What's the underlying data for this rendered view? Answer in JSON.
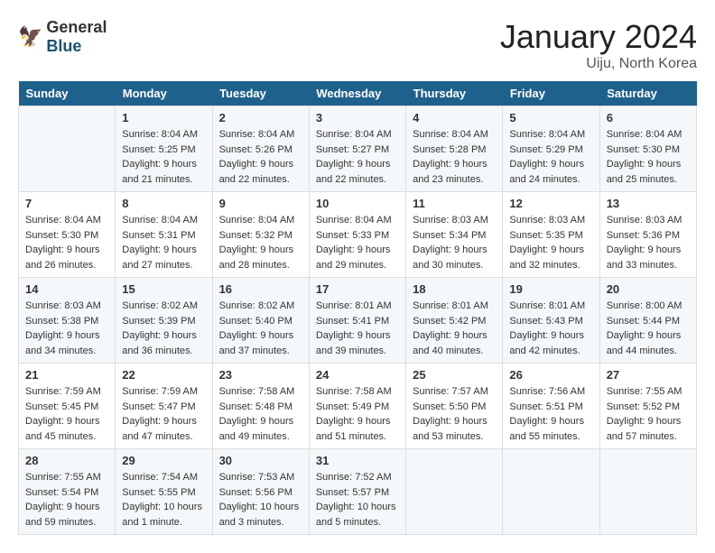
{
  "logo": {
    "general": "General",
    "blue": "Blue"
  },
  "title": {
    "month_year": "January 2024",
    "location": "Uiju, North Korea"
  },
  "headers": [
    "Sunday",
    "Monday",
    "Tuesday",
    "Wednesday",
    "Thursday",
    "Friday",
    "Saturday"
  ],
  "weeks": [
    [
      {
        "day": "",
        "content": ""
      },
      {
        "day": "1",
        "content": "Sunrise: 8:04 AM\nSunset: 5:25 PM\nDaylight: 9 hours\nand 21 minutes."
      },
      {
        "day": "2",
        "content": "Sunrise: 8:04 AM\nSunset: 5:26 PM\nDaylight: 9 hours\nand 22 minutes."
      },
      {
        "day": "3",
        "content": "Sunrise: 8:04 AM\nSunset: 5:27 PM\nDaylight: 9 hours\nand 22 minutes."
      },
      {
        "day": "4",
        "content": "Sunrise: 8:04 AM\nSunset: 5:28 PM\nDaylight: 9 hours\nand 23 minutes."
      },
      {
        "day": "5",
        "content": "Sunrise: 8:04 AM\nSunset: 5:29 PM\nDaylight: 9 hours\nand 24 minutes."
      },
      {
        "day": "6",
        "content": "Sunrise: 8:04 AM\nSunset: 5:30 PM\nDaylight: 9 hours\nand 25 minutes."
      }
    ],
    [
      {
        "day": "7",
        "content": "Sunrise: 8:04 AM\nSunset: 5:30 PM\nDaylight: 9 hours\nand 26 minutes."
      },
      {
        "day": "8",
        "content": "Sunrise: 8:04 AM\nSunset: 5:31 PM\nDaylight: 9 hours\nand 27 minutes."
      },
      {
        "day": "9",
        "content": "Sunrise: 8:04 AM\nSunset: 5:32 PM\nDaylight: 9 hours\nand 28 minutes."
      },
      {
        "day": "10",
        "content": "Sunrise: 8:04 AM\nSunset: 5:33 PM\nDaylight: 9 hours\nand 29 minutes."
      },
      {
        "day": "11",
        "content": "Sunrise: 8:03 AM\nSunset: 5:34 PM\nDaylight: 9 hours\nand 30 minutes."
      },
      {
        "day": "12",
        "content": "Sunrise: 8:03 AM\nSunset: 5:35 PM\nDaylight: 9 hours\nand 32 minutes."
      },
      {
        "day": "13",
        "content": "Sunrise: 8:03 AM\nSunset: 5:36 PM\nDaylight: 9 hours\nand 33 minutes."
      }
    ],
    [
      {
        "day": "14",
        "content": "Sunrise: 8:03 AM\nSunset: 5:38 PM\nDaylight: 9 hours\nand 34 minutes."
      },
      {
        "day": "15",
        "content": "Sunrise: 8:02 AM\nSunset: 5:39 PM\nDaylight: 9 hours\nand 36 minutes."
      },
      {
        "day": "16",
        "content": "Sunrise: 8:02 AM\nSunset: 5:40 PM\nDaylight: 9 hours\nand 37 minutes."
      },
      {
        "day": "17",
        "content": "Sunrise: 8:01 AM\nSunset: 5:41 PM\nDaylight: 9 hours\nand 39 minutes."
      },
      {
        "day": "18",
        "content": "Sunrise: 8:01 AM\nSunset: 5:42 PM\nDaylight: 9 hours\nand 40 minutes."
      },
      {
        "day": "19",
        "content": "Sunrise: 8:01 AM\nSunset: 5:43 PM\nDaylight: 9 hours\nand 42 minutes."
      },
      {
        "day": "20",
        "content": "Sunrise: 8:00 AM\nSunset: 5:44 PM\nDaylight: 9 hours\nand 44 minutes."
      }
    ],
    [
      {
        "day": "21",
        "content": "Sunrise: 7:59 AM\nSunset: 5:45 PM\nDaylight: 9 hours\nand 45 minutes."
      },
      {
        "day": "22",
        "content": "Sunrise: 7:59 AM\nSunset: 5:47 PM\nDaylight: 9 hours\nand 47 minutes."
      },
      {
        "day": "23",
        "content": "Sunrise: 7:58 AM\nSunset: 5:48 PM\nDaylight: 9 hours\nand 49 minutes."
      },
      {
        "day": "24",
        "content": "Sunrise: 7:58 AM\nSunset: 5:49 PM\nDaylight: 9 hours\nand 51 minutes."
      },
      {
        "day": "25",
        "content": "Sunrise: 7:57 AM\nSunset: 5:50 PM\nDaylight: 9 hours\nand 53 minutes."
      },
      {
        "day": "26",
        "content": "Sunrise: 7:56 AM\nSunset: 5:51 PM\nDaylight: 9 hours\nand 55 minutes."
      },
      {
        "day": "27",
        "content": "Sunrise: 7:55 AM\nSunset: 5:52 PM\nDaylight: 9 hours\nand 57 minutes."
      }
    ],
    [
      {
        "day": "28",
        "content": "Sunrise: 7:55 AM\nSunset: 5:54 PM\nDaylight: 9 hours\nand 59 minutes."
      },
      {
        "day": "29",
        "content": "Sunrise: 7:54 AM\nSunset: 5:55 PM\nDaylight: 10 hours\nand 1 minute."
      },
      {
        "day": "30",
        "content": "Sunrise: 7:53 AM\nSunset: 5:56 PM\nDaylight: 10 hours\nand 3 minutes."
      },
      {
        "day": "31",
        "content": "Sunrise: 7:52 AM\nSunset: 5:57 PM\nDaylight: 10 hours\nand 5 minutes."
      },
      {
        "day": "",
        "content": ""
      },
      {
        "day": "",
        "content": ""
      },
      {
        "day": "",
        "content": ""
      }
    ]
  ]
}
